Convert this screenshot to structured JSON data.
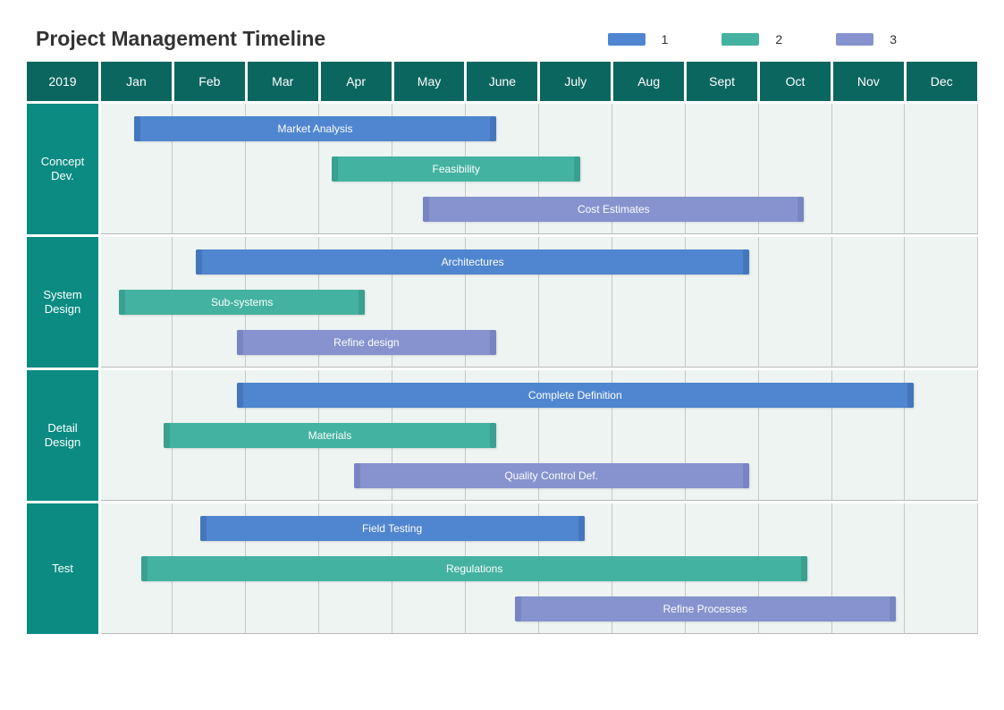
{
  "title": "Project Management Timeline",
  "legend": [
    {
      "label": "1",
      "color": "#4f86cf",
      "edge": "#4476bd"
    },
    {
      "label": "2",
      "color": "#43b2a0",
      "edge": "#3aa08f"
    },
    {
      "label": "3",
      "color": "#8693cf",
      "edge": "#7885c2"
    }
  ],
  "colors": {
    "header_bg": "#0c6660",
    "phase_bg": "#0b8b82",
    "area_bg": "#edf4f2"
  },
  "year": "2019",
  "months": [
    "Jan",
    "Feb",
    "Mar",
    "Apr",
    "May",
    "June",
    "July",
    "Aug",
    "Sept",
    "Oct",
    "Nov",
    "Dec"
  ],
  "chart_data": {
    "type": "gantt",
    "axis": {
      "unit": "month",
      "start": 0,
      "end": 12,
      "year": 2019,
      "labels": [
        "Jan",
        "Feb",
        "Mar",
        "Apr",
        "May",
        "June",
        "July",
        "Aug",
        "Sept",
        "Oct",
        "Nov",
        "Dec"
      ]
    },
    "phases": [
      {
        "name": "Concept Dev.",
        "tasks": [
          {
            "label": "Market Analysis",
            "series": 1,
            "start": 0.45,
            "end": 5.4
          },
          {
            "label": "Feasibility",
            "series": 2,
            "start": 3.15,
            "end": 6.55
          },
          {
            "label": "Cost Estimates",
            "series": 3,
            "start": 4.4,
            "end": 9.6
          }
        ]
      },
      {
        "name": "System Design",
        "tasks": [
          {
            "label": "Architectures",
            "series": 1,
            "start": 1.3,
            "end": 8.85
          },
          {
            "label": "Sub-systems",
            "series": 2,
            "start": 0.25,
            "end": 3.6
          },
          {
            "label": "Refine design",
            "series": 3,
            "start": 1.85,
            "end": 5.4
          }
        ]
      },
      {
        "name": "Detail Design",
        "tasks": [
          {
            "label": "Complete Definition",
            "series": 1,
            "start": 1.85,
            "end": 11.1
          },
          {
            "label": "Materials",
            "series": 2,
            "start": 0.85,
            "end": 5.4
          },
          {
            "label": "Quality Control Def.",
            "series": 3,
            "start": 3.45,
            "end": 8.85
          }
        ]
      },
      {
        "name": "Test",
        "tasks": [
          {
            "label": "Field Testing",
            "series": 1,
            "start": 1.35,
            "end": 6.6
          },
          {
            "label": "Regulations",
            "series": 2,
            "start": 0.55,
            "end": 9.65
          },
          {
            "label": "Refine Processes",
            "series": 3,
            "start": 5.65,
            "end": 10.85
          }
        ]
      }
    ]
  }
}
